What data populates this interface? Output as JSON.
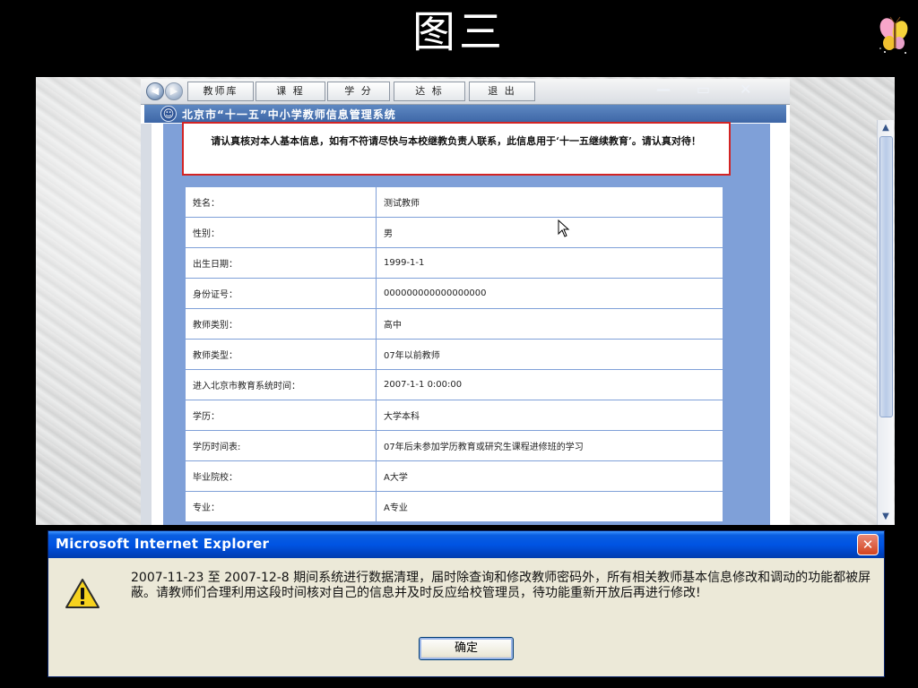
{
  "slide": {
    "title": "图三"
  },
  "browser": {
    "tabs": [
      "教师库",
      "课 程",
      "学 分",
      "达 标",
      "退 出"
    ],
    "app_title": "北京市“十一五”中小学教师信息管理系统",
    "notice": "请认真核对本人基本信息，如有不符请尽快与本校继教负责人联系，此信息用于‘十一五继续教育’。请认真对待！",
    "fields": [
      {
        "label": "姓名：",
        "value": "测试教师"
      },
      {
        "label": "性别：",
        "value": "男"
      },
      {
        "label": "出生日期：",
        "value": "1999-1-1"
      },
      {
        "label": "身份证号：",
        "value": "000000000000000000"
      },
      {
        "label": "教师类别：",
        "value": "高中"
      },
      {
        "label": "教师类型：",
        "value": "07年以前教师"
      },
      {
        "label": "进入北京市教育系统时间：",
        "value": "2007-1-1 0:00:00"
      },
      {
        "label": "学历：",
        "value": "大学本科"
      },
      {
        "label": "学历时间表:",
        "value": "07年后未参加学历教育或研究生课程进修班的学习"
      },
      {
        "label": "毕业院校：",
        "value": "A大学"
      },
      {
        "label": "专业：",
        "value": "A专业"
      }
    ]
  },
  "dialog": {
    "title": "Microsoft Internet Explorer",
    "message": "2007-11-23 至 2007-12-8 期间系统进行数据清理，届时除查询和修改教师密码外，所有相关教师基本信息修改和调动的功能都被屏蔽。请教师们合理利用这段时间核对自己的信息并及时反应给校管理员，待功能重新开放后再进行修改!",
    "ok_label": "确定",
    "icon": "warning-icon"
  },
  "colors": {
    "panel_blue": "#7fa0d8",
    "notice_border": "#d32424",
    "dialog_titlebar": "#0054e3",
    "dialog_bg": "#ece9d8"
  }
}
